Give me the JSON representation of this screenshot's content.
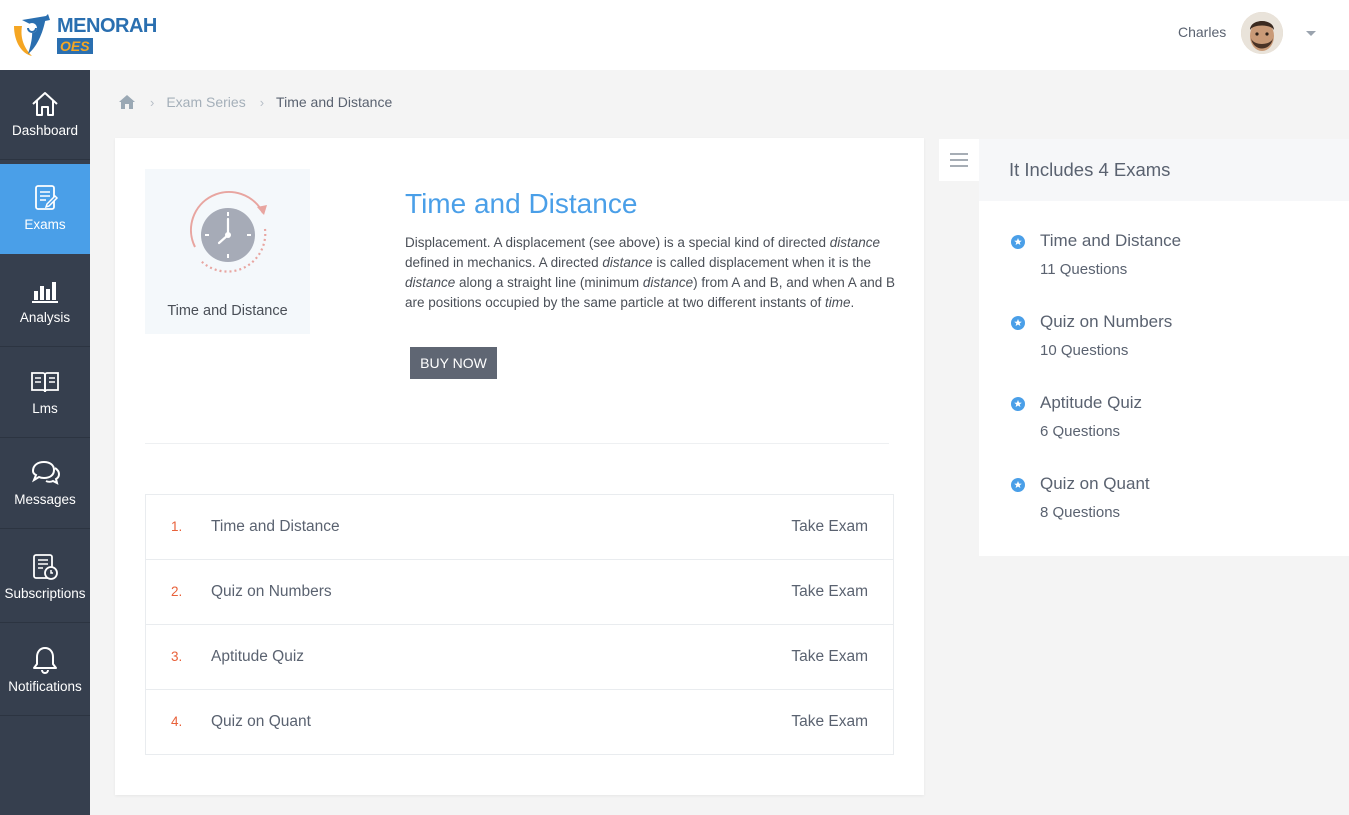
{
  "brand": {
    "name": "MENORAH",
    "sub": "OES",
    "primary_color": "#2a6fb0",
    "accent_color": "#f5a623"
  },
  "header": {
    "user_name": "Charles"
  },
  "sidebar": {
    "items": [
      {
        "label": "Dashboard",
        "icon": "home-icon",
        "active": false
      },
      {
        "label": "Exams",
        "icon": "exam-list-icon",
        "active": true
      },
      {
        "label": "Analysis",
        "icon": "bar-chart-icon",
        "active": false
      },
      {
        "label": "Lms",
        "icon": "open-book-icon",
        "active": false
      },
      {
        "label": "Messages",
        "icon": "chat-bubbles-icon",
        "active": false
      },
      {
        "label": "Subscriptions",
        "icon": "subscription-icon",
        "active": false
      },
      {
        "label": "Notifications",
        "icon": "bell-icon",
        "active": false
      }
    ],
    "active_color": "#4a9fe8",
    "background": "#363f4e"
  },
  "breadcrumb": {
    "home_icon": "home-icon",
    "items": [
      "Exam Series",
      "Time and Distance"
    ]
  },
  "series": {
    "thumbnail_caption": "Time and Distance",
    "title": "Time and Distance",
    "description": [
      {
        "text": "Displacement. A displacement (see above) is a special kind of directed ",
        "em": false
      },
      {
        "text": "distance",
        "em": true
      },
      {
        "text": " defined in mechanics. A directed ",
        "em": false
      },
      {
        "text": "distance",
        "em": true
      },
      {
        "text": " is called displacement when it is the ",
        "em": false
      },
      {
        "text": "distance",
        "em": true
      },
      {
        "text": " along a straight line (minimum ",
        "em": false
      },
      {
        "text": "distance",
        "em": true
      },
      {
        "text": ") from A and B, and when A and B are positions occupied by the same particle at two different instants of ",
        "em": false
      },
      {
        "text": "time",
        "em": true
      },
      {
        "text": ".",
        "em": false
      }
    ],
    "buy_label": "BUY NOW"
  },
  "exams": [
    {
      "num": "1.",
      "name": "Time and Distance",
      "action": "Take Exam"
    },
    {
      "num": "2.",
      "name": "Quiz on Numbers",
      "action": "Take Exam"
    },
    {
      "num": "3.",
      "name": "Aptitude Quiz",
      "action": "Take Exam"
    },
    {
      "num": "4.",
      "name": "Quiz on Quant",
      "action": "Take Exam"
    }
  ],
  "includes": {
    "title": "It Includes 4 Exams",
    "items": [
      {
        "name": "Time and Distance",
        "count": "11 Questions"
      },
      {
        "name": "Quiz on Numbers",
        "count": "10 Questions"
      },
      {
        "name": "Aptitude Quiz",
        "count": "6 Questions"
      },
      {
        "name": "Quiz on Quant",
        "count": "8 Questions"
      }
    ]
  }
}
